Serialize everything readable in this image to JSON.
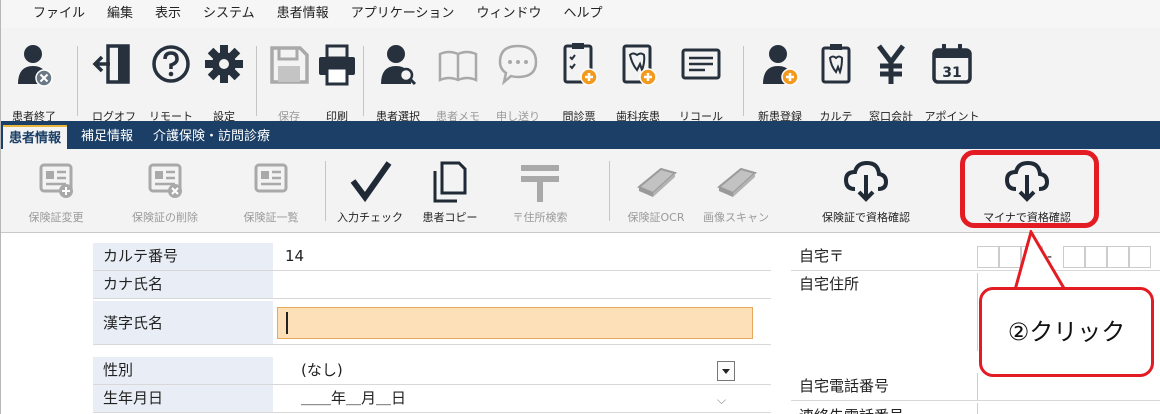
{
  "menu": {
    "items": [
      "ファイル",
      "編集",
      "表示",
      "システム",
      "患者情報",
      "アプリケーション",
      "ウィンドウ",
      "ヘルプ"
    ]
  },
  "toolbar": {
    "buttons": [
      {
        "label": "患者終了",
        "icon": "patient-close-icon",
        "enabled": true
      },
      {
        "label": "ログオフ",
        "icon": "logoff-icon",
        "enabled": true
      },
      {
        "label": "リモート",
        "icon": "remote-help-icon",
        "enabled": true
      },
      {
        "label": "設定",
        "icon": "gear-icon",
        "enabled": true
      },
      {
        "label": "保存",
        "icon": "save-icon",
        "enabled": false
      },
      {
        "label": "印刷",
        "icon": "printer-icon",
        "enabled": true
      },
      {
        "label": "患者選択",
        "icon": "patient-search-icon",
        "enabled": true
      },
      {
        "label": "患者メモ",
        "icon": "book-icon",
        "enabled": false
      },
      {
        "label": "申し送り",
        "icon": "chat-bubble-icon",
        "enabled": false
      },
      {
        "label": "問診票",
        "icon": "questionnaire-icon",
        "enabled": true
      },
      {
        "label": "歯科疾患",
        "icon": "dental-disease-icon",
        "enabled": true
      },
      {
        "label": "リコール",
        "icon": "recall-card-icon",
        "enabled": true
      },
      {
        "label": "新患登録",
        "icon": "new-patient-icon",
        "enabled": true
      },
      {
        "label": "カルテ",
        "icon": "tooth-chart-icon",
        "enabled": true
      },
      {
        "label": "窓口会計",
        "icon": "yen-icon",
        "enabled": true
      },
      {
        "label": "アポイント",
        "icon": "calendar-icon",
        "enabled": true
      }
    ],
    "calendar_day": "31"
  },
  "tabs": [
    {
      "label": "患者情報",
      "active": true
    },
    {
      "label": "補足情報",
      "active": false
    },
    {
      "label": "介護保険・訪問診療",
      "active": false
    }
  ],
  "subtoolbar": {
    "buttons": [
      {
        "label": "保険証変更",
        "icon": "card-edit-icon",
        "enabled": false
      },
      {
        "label": "保険証の削除",
        "icon": "card-delete-icon",
        "enabled": false
      },
      {
        "label": "保険証一覧",
        "icon": "card-list-icon",
        "enabled": false
      },
      {
        "label": "入力チェック",
        "icon": "checkmark-icon",
        "enabled": true
      },
      {
        "label": "患者コピー",
        "icon": "copy-icon",
        "enabled": true
      },
      {
        "label": "〒住所検索",
        "icon": "postal-mark-icon",
        "enabled": false
      },
      {
        "label": "保険証OCR",
        "icon": "scanner-icon",
        "enabled": false
      },
      {
        "label": "画像スキャン",
        "icon": "scanner-icon",
        "enabled": false
      },
      {
        "label": "保険証で資格確認",
        "icon": "cloud-download-icon",
        "enabled": true
      },
      {
        "label": "マイナで資格確認",
        "icon": "cloud-download-icon",
        "enabled": true
      }
    ]
  },
  "form": {
    "karte_no": {
      "label": "カルテ番号",
      "value": "14"
    },
    "kana_name": {
      "label": "カナ氏名",
      "value": ""
    },
    "kanji_name": {
      "label": "漢字氏名",
      "value": ""
    },
    "gender": {
      "label": "性別",
      "value": "(なし)"
    },
    "birthdate": {
      "label": "生年月日",
      "value": "＿＿年＿月＿日"
    },
    "home_postal": {
      "label": "自宅〒",
      "value": "-"
    },
    "home_address": {
      "label": "自宅住所",
      "value": ""
    },
    "home_phone": {
      "label": "自宅電話番号",
      "value": ""
    },
    "contact_phone": {
      "label": "連絡先電話番号",
      "value": ""
    }
  },
  "callout": {
    "text": "②クリック"
  },
  "colors": {
    "tab_bar": "#1b3f66",
    "highlight": "#e31b23",
    "input_focus": "#fde0b8",
    "label_bg": "#e9eef6",
    "icon_dark": "#26313d",
    "icon_orange": "#f39a1e"
  }
}
